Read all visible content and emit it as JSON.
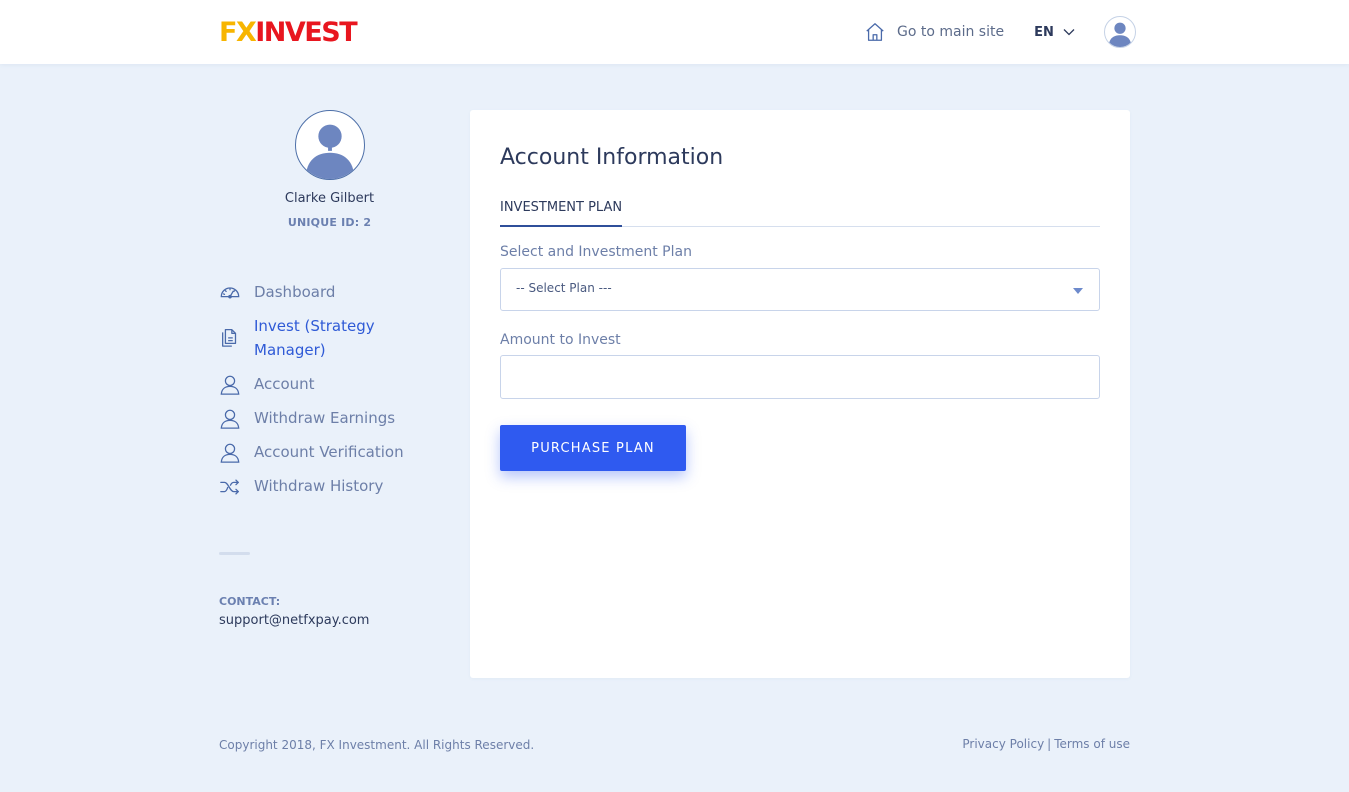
{
  "header": {
    "logo_fx": "FX",
    "logo_invest": "INVEST",
    "go_main_label": "Go to main site",
    "language": "EN",
    "icons": {
      "home": "home-icon",
      "chevron": "chevron-down-icon",
      "avatar": "user-avatar"
    }
  },
  "profile": {
    "name": "Clarke Gilbert",
    "unique_id": "UNIQUE ID: 2"
  },
  "sidebar": {
    "items": [
      {
        "label": "Dashboard",
        "icon": "dashboard-icon",
        "active": false
      },
      {
        "label": "Invest (Strategy Manager)",
        "icon": "documents-icon",
        "active": true
      },
      {
        "label": "Account",
        "icon": "user-icon",
        "active": false
      },
      {
        "label": "Withdraw Earnings",
        "icon": "user-icon",
        "active": false
      },
      {
        "label": "Account Verification",
        "icon": "user-icon",
        "active": false
      },
      {
        "label": "Withdraw History",
        "icon": "shuffle-icon",
        "active": false
      }
    ],
    "contact_label": "CONTACT:",
    "contact_email": "support@netfxpay.com"
  },
  "main": {
    "title": "Account Information",
    "tabs": [
      {
        "label": "INVESTMENT PLAN",
        "active": true
      }
    ],
    "plan_label": "Select and Investment Plan",
    "plan_selected": "-- Select Plan ---",
    "amount_label": "Amount to Invest",
    "amount_value": "",
    "purchase_button": "PURCHASE PLAN"
  },
  "footer": {
    "copyright": "Copyright 2018, FX Investment. All Rights Reserved.",
    "privacy": "Privacy Policy",
    "separator": "|",
    "terms": "Terms of use"
  },
  "colors": {
    "accent": "#2f5af0",
    "logo_yellow": "#f7b500",
    "logo_red": "#e8161f",
    "background": "#eaf1fa",
    "active_nav": "#2f5ad6"
  }
}
